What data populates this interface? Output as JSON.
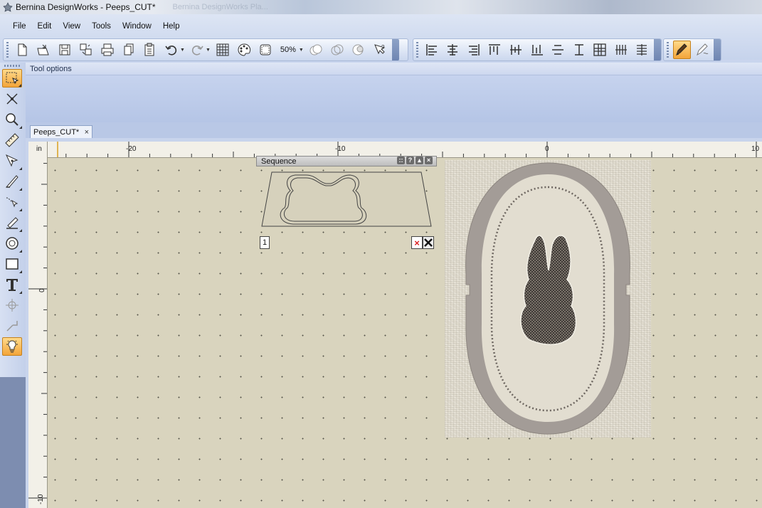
{
  "window": {
    "title": "Bernina DesignWorks - Peeps_CUT*",
    "background_title": "Bernina DesignWorks Pla..."
  },
  "menubar": [
    "File",
    "Edit",
    "View",
    "Tools",
    "Window",
    "Help"
  ],
  "toolbar": {
    "zoom_label": "50%",
    "main_icons": [
      "new-file-icon",
      "open-file-icon",
      "save-icon",
      "import-icon",
      "print-icon",
      "copy-icon",
      "paste-icon",
      "undo-icon",
      "redo-icon",
      "grid-icon",
      "color-palette-icon",
      "hoop-icon",
      "zoom-icon",
      "weld-icon",
      "intersect-icon",
      "trim-icon",
      "help-icon"
    ],
    "align_icons": [
      "align-left-icon",
      "align-center-icon",
      "align-right-icon",
      "distribute-left-icon",
      "distribute-center-h-icon",
      "distribute-right-icon",
      "align-top-icon",
      "align-middle-icon",
      "align-bottom-icon",
      "distribute-grid-icon",
      "distribute-h-icon",
      "distribute-v-icon"
    ],
    "right_icons": [
      "pen-tool-icon",
      "freehand-tool-icon"
    ]
  },
  "left_tools": [
    "select-tool-icon",
    "cut-points-icon",
    "zoom-tool-icon",
    "ruler-tool-icon",
    "pen-tool-icon",
    "knife-tool-icon",
    "bezier-tool-icon",
    "paint-tool-icon",
    "circle-tool-icon",
    "rectangle-tool-icon",
    "text-tool-icon",
    "rotate-tool-icon",
    "mirror-tool-icon",
    "lightbulb-icon"
  ],
  "tool_options": {
    "label": "Tool options"
  },
  "document_tab": {
    "label": "Peeps_CUT*",
    "close": "×"
  },
  "ruler": {
    "unit": "in",
    "top_labels": [
      "-20",
      "-10",
      "0",
      "10"
    ],
    "left_labels": [
      "0",
      "-10"
    ]
  },
  "sequence_panel": {
    "title": "Sequence",
    "controls": [
      "::",
      "?",
      "▴",
      "×"
    ],
    "item_number": "1"
  },
  "colors": {
    "selected_tool": "#f3a53a",
    "canvas": "#d9d4be",
    "fabric": "#e2ddd0",
    "hoop": "#a39c97",
    "bunny": "#4a4540"
  }
}
